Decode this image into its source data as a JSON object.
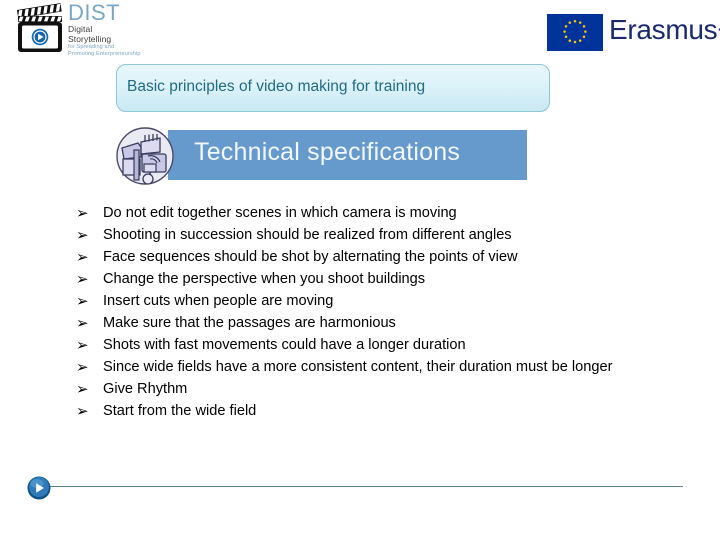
{
  "header": {
    "dist_logo": {
      "icon": "clapperboard-play-icon",
      "title": "DIST",
      "line1": "Digital",
      "line2": "Storytelling",
      "line3": "for Spreading and",
      "line4": "Promoting Enterpreneurship",
      "title_color": "#7ba7c4"
    },
    "erasmus_logo": {
      "icon": "eu-flag-icon",
      "label": "Erasmus+",
      "flag_color": "#003399",
      "star_color": "#ffcc00",
      "text_color": "#1a2a6c"
    }
  },
  "title_banner": {
    "text": "Basic principles of video making for training",
    "text_color": "#1f6b80",
    "fill_color": "#ddf2f9",
    "border_color": "#8fc6d8"
  },
  "subtitle_bar": {
    "text": "Technical specifications",
    "text_color": "#f2f7fc",
    "fill_color": "#6699cc",
    "icon": "technical-tools-icon"
  },
  "bullets": {
    "marker": "➢",
    "items": [
      "Do not edit together scenes in which camera is moving",
      "Shooting in succession should be realized from different angles",
      "Face sequences should be shot by alternating the points of view",
      "Change the perspective when you shoot buildings",
      "Insert cuts when people are moving",
      "Make sure that the passages are harmonious",
      "Shots with fast movements could have a longer duration",
      "Since wide fields have a more consistent content, their duration must be longer",
      "Give Rhythm",
      "Start from the wide field"
    ]
  },
  "footer": {
    "icon": "play-button-icon",
    "line_color": "#56808f"
  }
}
